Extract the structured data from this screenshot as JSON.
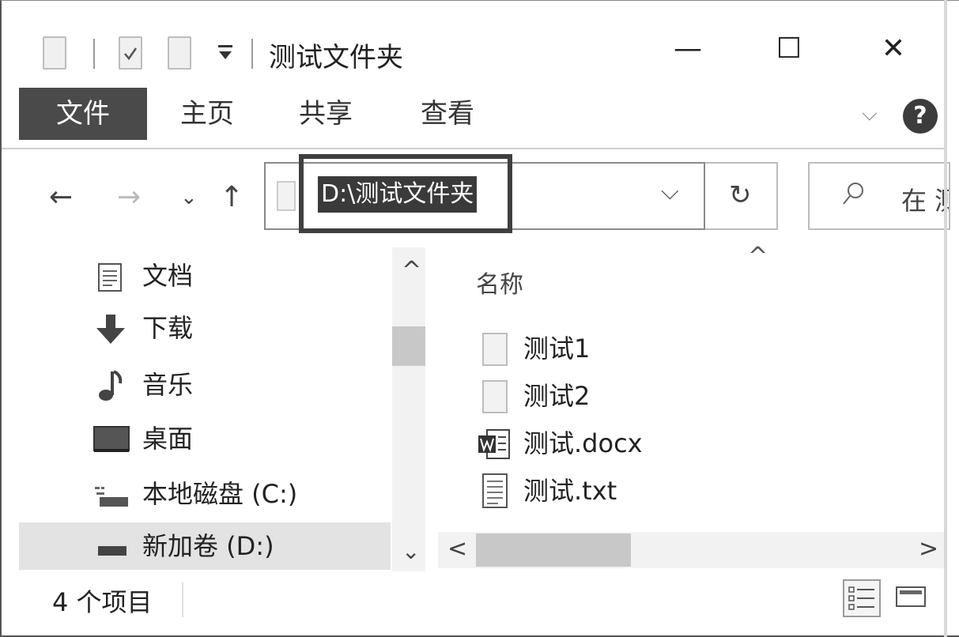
{
  "window": {
    "title": "测试文件夹",
    "controls": {
      "minimize": "—",
      "maximize": "☐",
      "close": "✕"
    }
  },
  "ribbon": {
    "tabs": [
      {
        "label": "文件"
      },
      {
        "label": "主页"
      },
      {
        "label": "共享"
      },
      {
        "label": "查看"
      }
    ],
    "expand": "⌵",
    "help": "?"
  },
  "address": {
    "path": "D:\\测试文件夹",
    "dropdown": "⌵",
    "refresh": "↻",
    "search_placeholder": "在 测"
  },
  "nav": {
    "back": "←",
    "forward": "→",
    "recent": "⌄",
    "up": "↑",
    "items": [
      {
        "label": "文档",
        "icon": "document-icon"
      },
      {
        "label": "下载",
        "icon": "download-icon"
      },
      {
        "label": "音乐",
        "icon": "music-icon"
      },
      {
        "label": "桌面",
        "icon": "desktop-icon"
      },
      {
        "label": "本地磁盘 (C:)",
        "icon": "drive-icon"
      },
      {
        "label": "新加卷 (D:)",
        "icon": "drive-icon"
      }
    ],
    "scroll_up": "^",
    "scroll_down": "⌄"
  },
  "files": {
    "column_name": "名称",
    "sort_indicator": "^",
    "items": [
      {
        "label": "测试1",
        "icon": "blank-file-icon"
      },
      {
        "label": "测试2",
        "icon": "blank-file-icon"
      },
      {
        "label": "测试.docx",
        "icon": "word-file-icon"
      },
      {
        "label": "测试.txt",
        "icon": "text-file-icon"
      }
    ],
    "scroll_left": "<",
    "scroll_right": ">"
  },
  "status": {
    "count": "4 个项目"
  },
  "colors": {
    "file_tab_bg": "#4a4a4a",
    "selection_bg": "#e3e3e3",
    "address_highlight": "#3a3a3a"
  }
}
